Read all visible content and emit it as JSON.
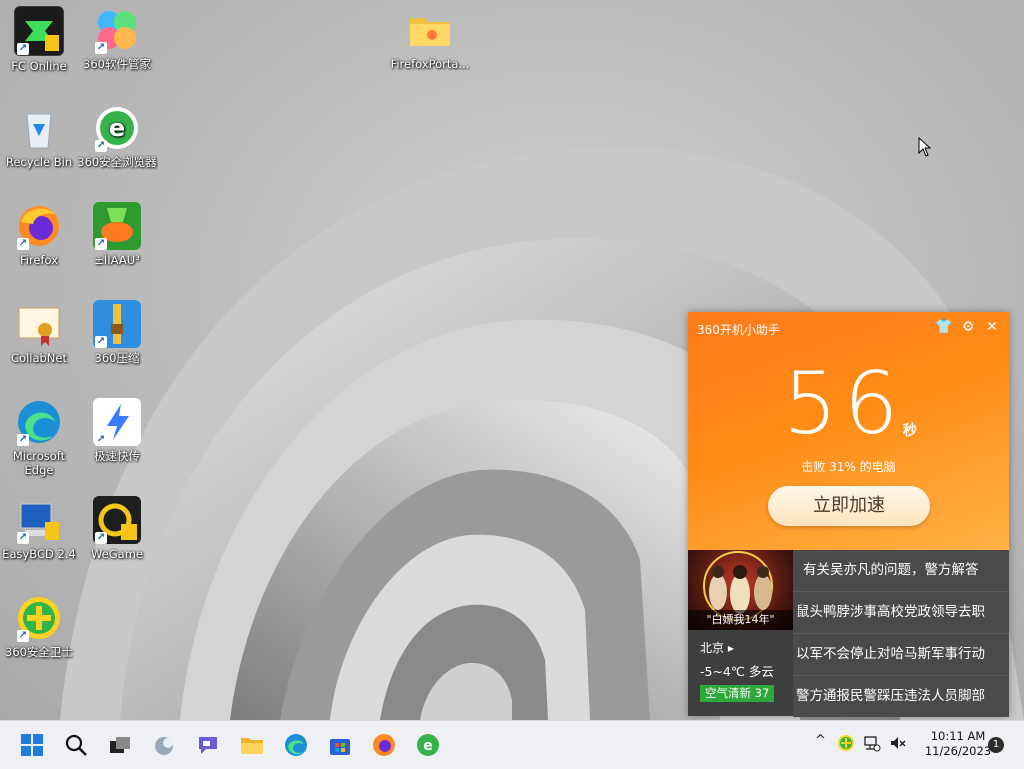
{
  "desktop": {
    "icons": [
      {
        "label": "FC Online",
        "icon": "fc-online-icon"
      },
      {
        "label": "360软件管家",
        "icon": "360-software-manager-icon"
      },
      {
        "label": "FirefoxPorta...",
        "icon": "folder-icon"
      },
      {
        "label": "Recycle Bin",
        "icon": "recycle-bin-icon"
      },
      {
        "label": "360安全浏览器",
        "icon": "360-browser-icon"
      },
      {
        "label": "Firefox",
        "icon": "firefox-icon"
      },
      {
        "label": "±ÌIAAU³",
        "icon": "game-icon"
      },
      {
        "label": "CollabNet",
        "icon": "certificate-icon"
      },
      {
        "label": "360压缩",
        "icon": "360-zip-icon"
      },
      {
        "label": "Microsoft Edge",
        "icon": "edge-icon"
      },
      {
        "label": "极速快传",
        "icon": "fast-transfer-icon"
      },
      {
        "label": "EasyBCD 2.4",
        "icon": "easybcd-icon"
      },
      {
        "label": "WeGame",
        "icon": "wegame-icon"
      },
      {
        "label": "360安全卫士",
        "icon": "360-security-icon"
      }
    ],
    "shortcut_glyph": "↗"
  },
  "widget": {
    "title": "360开机小助手",
    "boot_seconds": "56",
    "unit": "秒",
    "beat_text": "击败 31% 的电脑",
    "button_label": "立即加速",
    "thumb_caption": "\"白嫖我14年\"",
    "weather": {
      "city": "北京",
      "temp": "-5~4℃ 多云",
      "air": "空气清新 37"
    },
    "news": [
      "有关吴亦凡的问题，警方解答",
      "鼠头鸭脖涉事高校党政领导去职",
      "以军不会停止对哈马斯军事行动",
      "警方通报民警踩压违法人员脚部"
    ],
    "controls": {
      "skin": "👕",
      "settings": "⚙",
      "close": "✕"
    },
    "accent": "#ff8c16"
  },
  "taskbar": {
    "apps": [
      "start-icon",
      "search-icon",
      "task-view-icon",
      "widgets-icon",
      "chat-icon",
      "file-explorer-icon",
      "edge-icon",
      "store-icon",
      "firefox-icon",
      "360-browser-icon"
    ],
    "tray": {
      "chevron": "^"
    },
    "clock": {
      "time": "10:11 AM",
      "date": "11/26/2023"
    },
    "notification_count": "1"
  }
}
